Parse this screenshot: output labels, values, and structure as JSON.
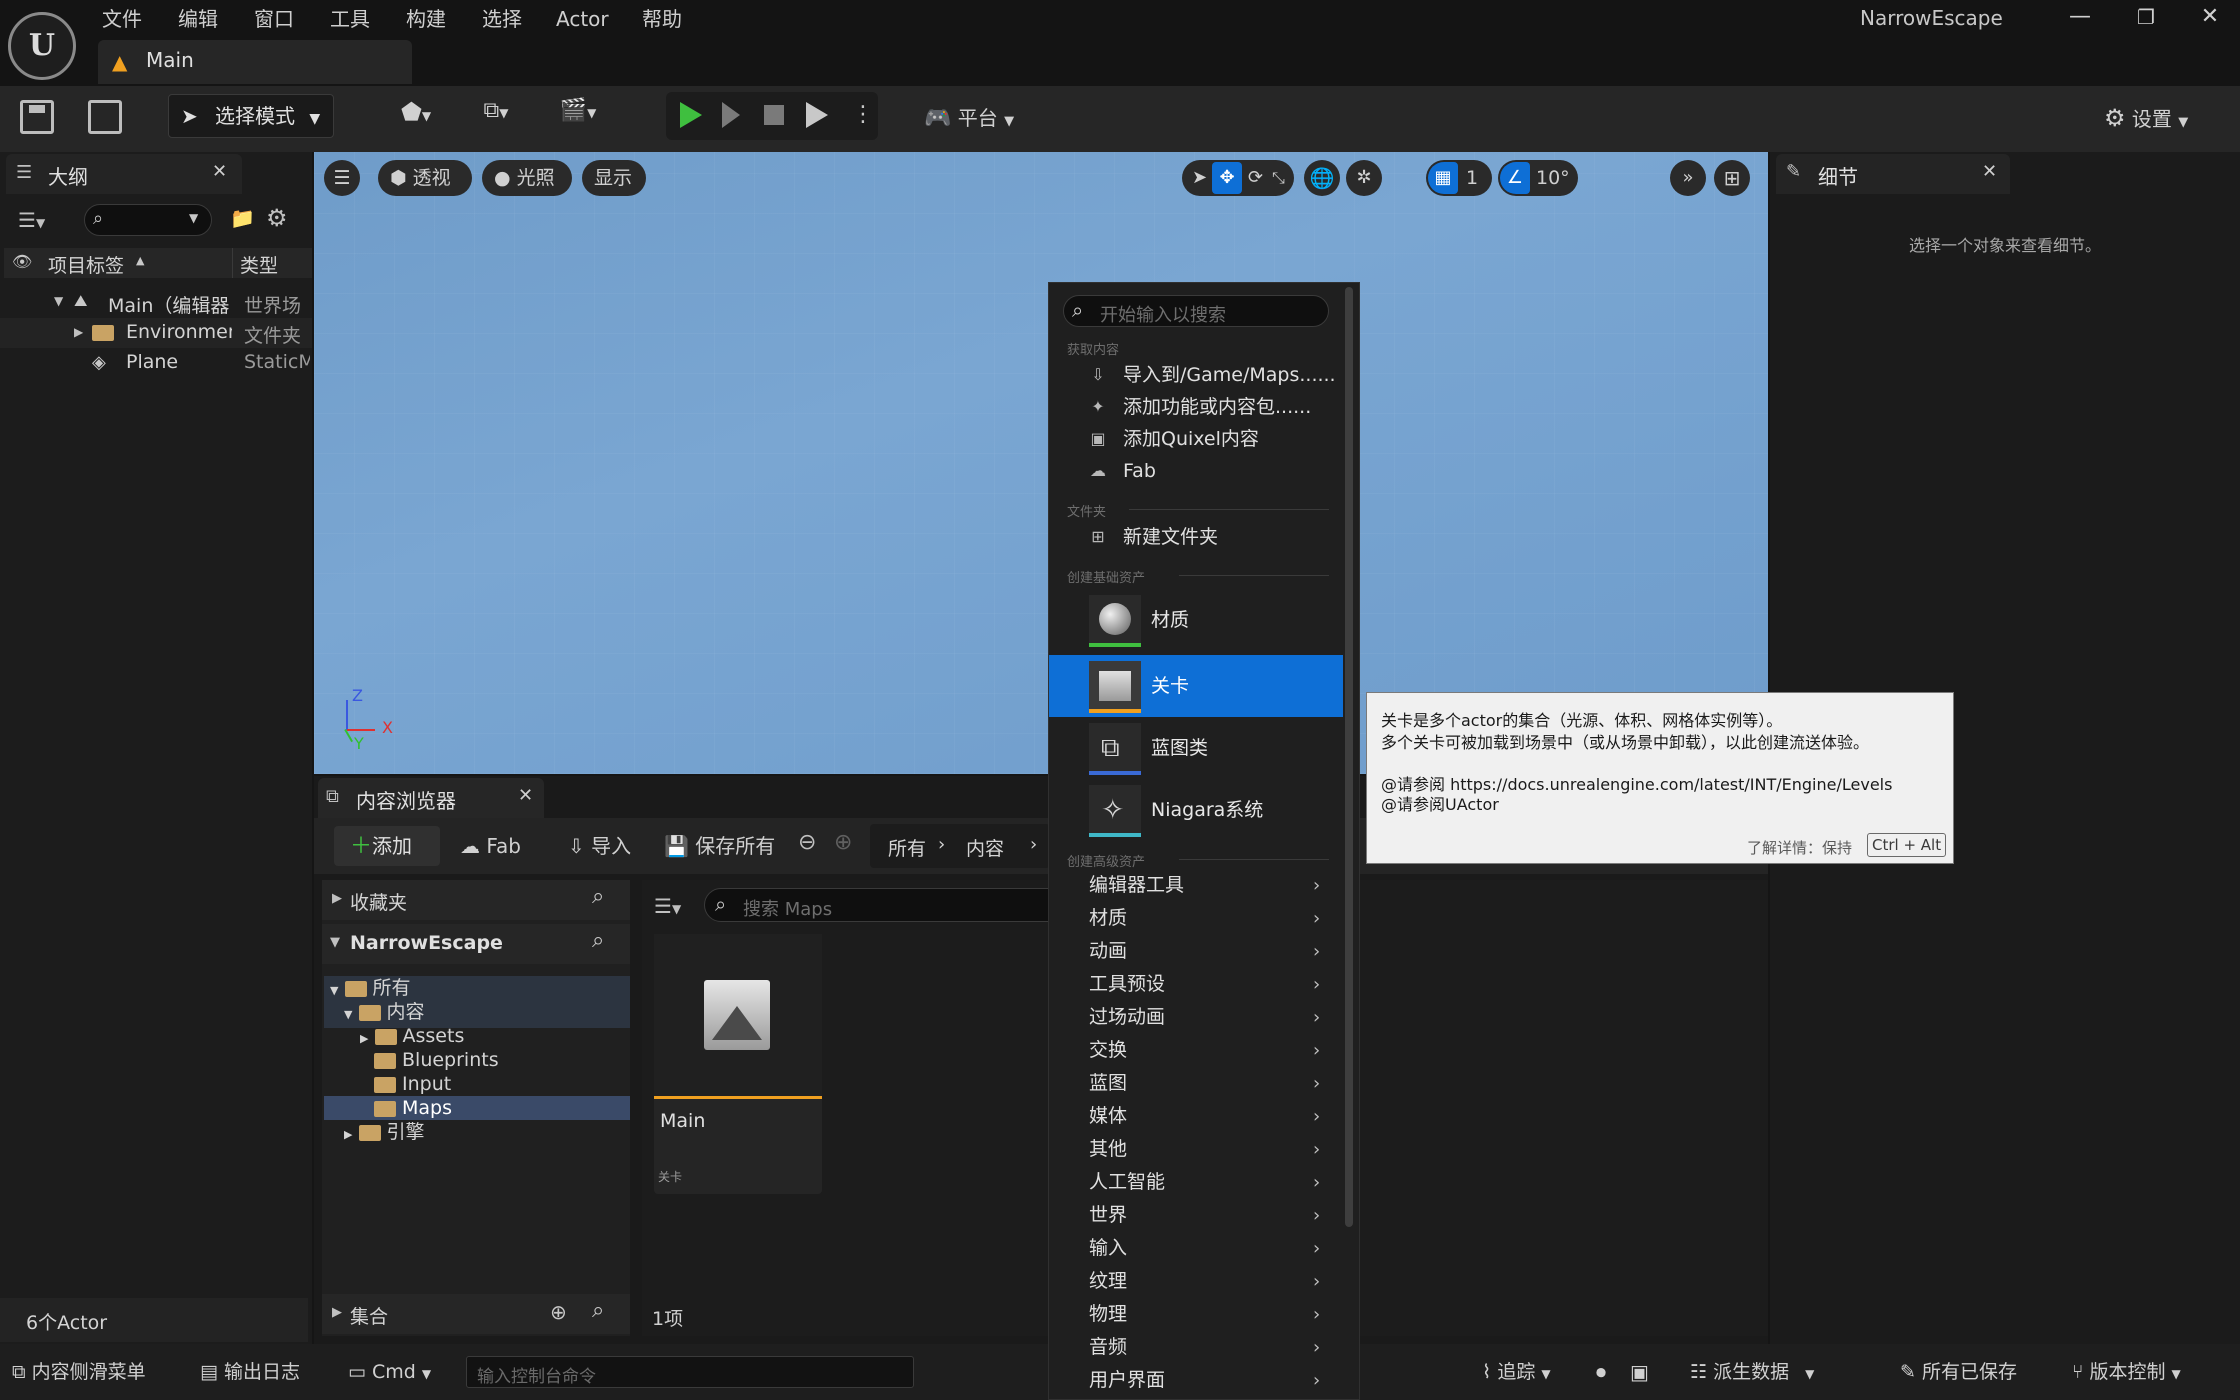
{
  "app": {
    "title": "NarrowEscape",
    "logo": "U",
    "menu": [
      "文件",
      "编辑",
      "窗口",
      "工具",
      "构建",
      "选择",
      "Actor",
      "帮助"
    ],
    "doc_tab": "Main",
    "window_buttons": [
      "—",
      "❐",
      "✕"
    ]
  },
  "toolbar": {
    "mode_label": "选择模式",
    "platform_label": "平台",
    "settings_label": "设置"
  },
  "outliner": {
    "tab": "大纲",
    "col_label": "项目标签",
    "col_type": "类型",
    "rows": [
      {
        "label": "Main（编辑器",
        "type": "世界场"
      },
      {
        "label": "Environment",
        "type": "文件夹"
      },
      {
        "label": "Plane",
        "type": "StaticM"
      }
    ],
    "footer": "6个Actor"
  },
  "viewport": {
    "perspective": "透视",
    "lighting": "光照",
    "show": "显示",
    "grid_value": "1",
    "angle_value": "10°",
    "axis_z": "Z",
    "axis_x": "X",
    "axis_y": "Y"
  },
  "details": {
    "tab": "细节",
    "empty_text": "选择一个对象来查看细节。"
  },
  "content_browser": {
    "tab": "内容浏览器",
    "add": "添加",
    "fab": "Fab",
    "import": "导入",
    "save_all": "保存所有",
    "path": [
      "所有",
      "内容"
    ],
    "favorites": "收藏夹",
    "project": "NarrowEscape",
    "tree": [
      {
        "label": "所有",
        "depth": 0
      },
      {
        "label": "内容",
        "depth": 1
      },
      {
        "label": "Assets",
        "depth": 2
      },
      {
        "label": "Blueprints",
        "depth": 2
      },
      {
        "label": "Input",
        "depth": 2
      },
      {
        "label": "Maps",
        "depth": 2
      },
      {
        "label": "引擎",
        "depth": 1
      }
    ],
    "collections": "集合",
    "search_placeholder": "搜索 Maps",
    "asset_name": "Main",
    "asset_type": "关卡",
    "item_count": "1项"
  },
  "statusbar": {
    "drawer": "内容侧滑菜单",
    "output_log": "输出日志",
    "cmd": "Cmd",
    "console_placeholder": "输入控制台命令",
    "trace": "追踪",
    "derived_data": "派生数据",
    "all_saved": "所有已保存",
    "source_control": "版本控制"
  },
  "context_menu": {
    "search_placeholder": "开始输入以搜索",
    "section_get": "获取内容",
    "get_items": [
      "导入到/Game/Maps......",
      "添加功能或内容包......",
      "添加Quixel内容",
      "Fab"
    ],
    "section_folder": "文件夹",
    "new_folder": "新建文件夹",
    "section_basic": "创建基础资产",
    "basic_assets": [
      "材质",
      "关卡",
      "蓝图类",
      "Niagara系统"
    ],
    "section_advanced": "创建高级资产",
    "advanced": [
      "编辑器工具",
      "材质",
      "动画",
      "工具预设",
      "过场动画",
      "交换",
      "蓝图",
      "媒体",
      "其他",
      "人工智能",
      "世界",
      "输入",
      "纹理",
      "物理",
      "音频",
      "用户界面"
    ]
  },
  "tooltip": {
    "line1": "关卡是多个actor的集合（光源、体积、网格体实例等）。",
    "line2": "多个关卡可被加载到场景中（或从场景中卸载），以此创建流送体验。",
    "line3": "@请参阅 https://docs.unrealengine.com/latest/INT/Engine/Levels",
    "line4": "@请参阅UActor",
    "more_label": "了解详情：保持",
    "shortcut": "Ctrl + Alt"
  },
  "colors": {
    "accent": "#0e6fd6",
    "play_green": "#3fbf3f",
    "level_orange": "#f0a020"
  }
}
